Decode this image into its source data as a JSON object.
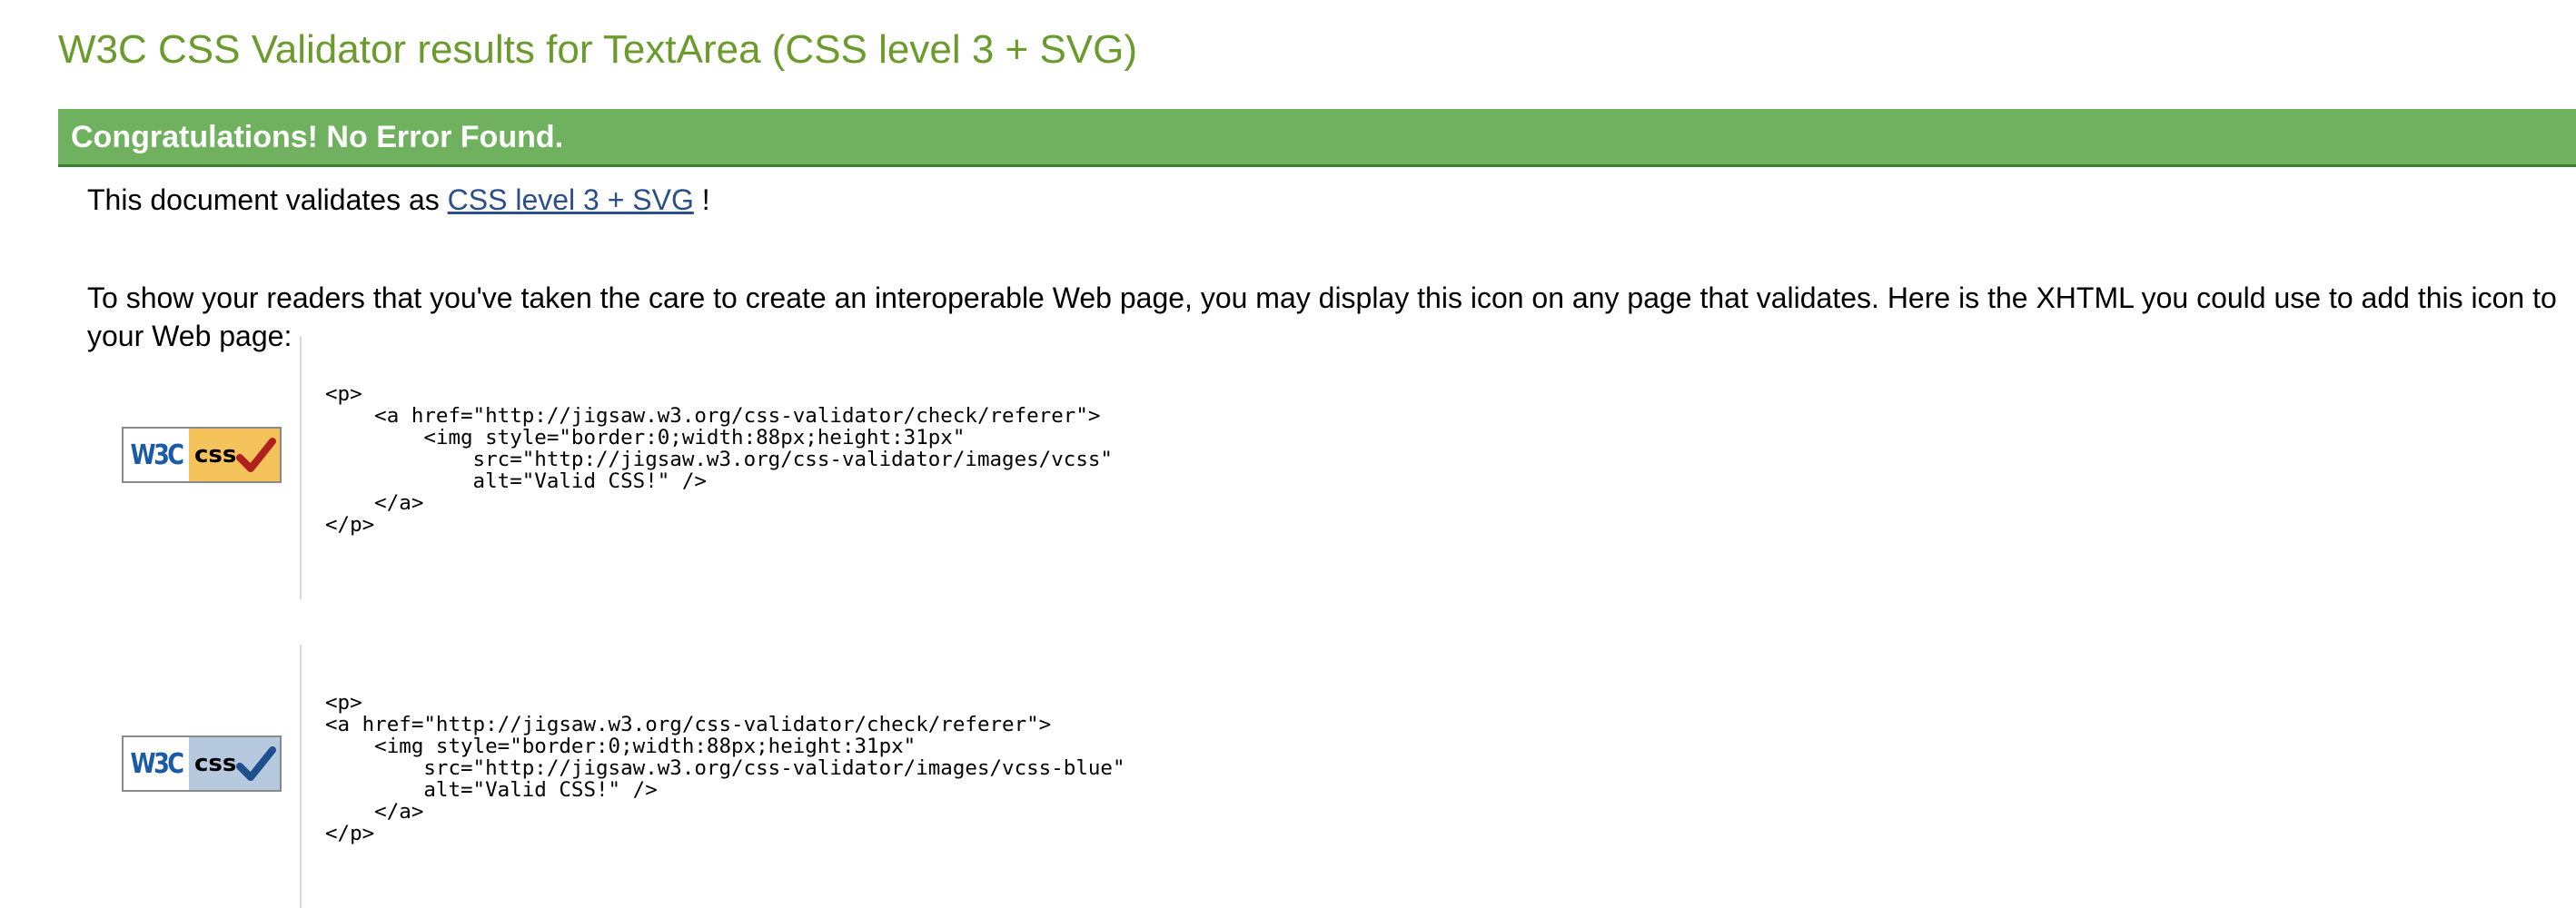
{
  "page": {
    "title": "W3C CSS Validator results for TextArea (CSS level 3 + SVG)"
  },
  "result": {
    "banner": "Congratulations! No Error Found."
  },
  "validation": {
    "prefix": "This document validates as",
    "link_label": "CSS level 3 + SVG",
    "suffix": "!"
  },
  "intro": {
    "text": "To show your readers that you've taken the care to create an interoperable Web page, you may display this icon on any page that validates. Here is the XHTML you could use to add this icon to your Web page:"
  },
  "badges": [
    {
      "w3c_text": "W3C",
      "css_text": "css",
      "color": "#f5c35c",
      "check_color": "#b21f1f",
      "code": "<p>\n    <a href=\"http://jigsaw.w3.org/css-validator/check/referer\">\n        <img style=\"border:0;width:88px;height:31px\"\n            src=\"http://jigsaw.w3.org/css-validator/images/vcss\"\n            alt=\"Valid CSS!\" />\n    </a>\n</p>"
    },
    {
      "w3c_text": "W3C",
      "css_text": "css",
      "color": "#b7c9df",
      "check_color": "#1f4f8c",
      "code": "<p>\n<a href=\"http://jigsaw.w3.org/css-validator/check/referer\">\n    <img style=\"border:0;width:88px;height:31px\"\n        src=\"http://jigsaw.w3.org/css-validator/images/vcss-blue\"\n        alt=\"Valid CSS!\" />\n    </a>\n</p>"
    }
  ],
  "colors": {
    "title": "#6b9b2c",
    "banner_bg": "#6fb15f",
    "link": "#2b4f8b"
  }
}
